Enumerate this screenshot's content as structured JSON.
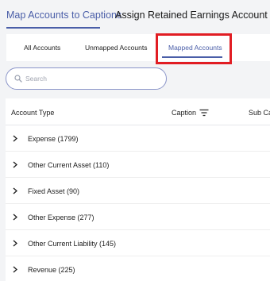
{
  "top_tabs": [
    {
      "label": "Map Accounts to Captions",
      "active": true
    },
    {
      "label": "Assign Retained Earnings Account",
      "active": false
    }
  ],
  "sub_tabs": [
    {
      "label": "All Accounts",
      "active": false
    },
    {
      "label": "Unmapped Accounts",
      "active": false
    },
    {
      "label": "Mapped Accounts",
      "active": true
    }
  ],
  "search": {
    "placeholder": "Search",
    "value": ""
  },
  "table": {
    "columns": [
      "Account Type",
      "Caption",
      "Sub Ca"
    ],
    "rows": [
      {
        "label": "Expense (1799)"
      },
      {
        "label": "Other Current Asset (110)"
      },
      {
        "label": "Fixed Asset (90)"
      },
      {
        "label": "Other Expense (277)"
      },
      {
        "label": "Other Current Liability (145)"
      },
      {
        "label": "Revenue (225)"
      }
    ]
  },
  "colors": {
    "accent": "#4a5ea8",
    "highlight": "#e11d23",
    "background": "#f3f4f6"
  },
  "icons": {
    "search": "search-icon",
    "filter": "filter-lines-icon",
    "expand": "chevron-right-icon"
  }
}
